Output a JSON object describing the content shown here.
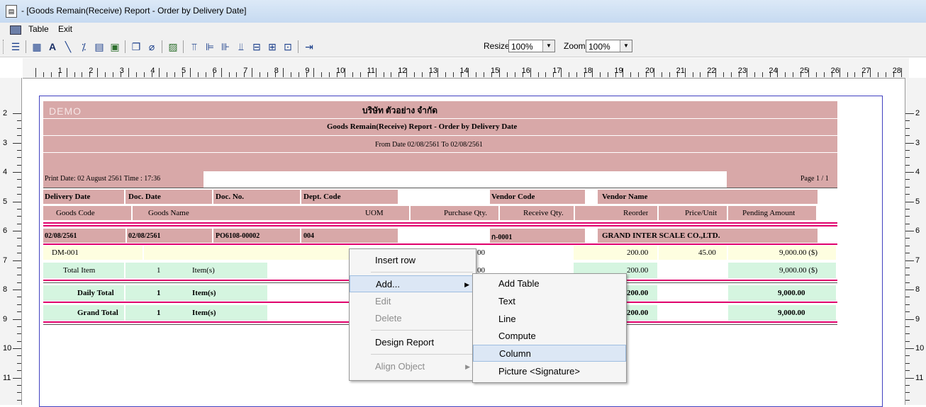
{
  "window": {
    "title": "- [Goods Remain(Receive) Report - Order by Delivery Date]"
  },
  "menu": {
    "items": [
      "Table",
      "Exit"
    ]
  },
  "toolbar": {
    "resize_label": "Resize:",
    "resize_value": "100%",
    "zoom_label": "Zoom:",
    "zoom_value": "100%"
  },
  "ruler": {
    "h": [
      "1",
      "2",
      "3",
      "4",
      "5",
      "6",
      "7",
      "8",
      "9",
      "10",
      "11",
      "12",
      "13",
      "14",
      "15",
      "16",
      "17",
      "18",
      "19",
      "20",
      "21",
      "22",
      "23",
      "24",
      "25",
      "26",
      "27",
      "28"
    ],
    "v": [
      "2",
      "3",
      "4",
      "5",
      "6",
      "7",
      "8",
      "9",
      "10",
      "11"
    ]
  },
  "report": {
    "watermark": "DEMO",
    "company": "บริษัท ตัวอย่าง จำกัด",
    "title": "Goods Remain(Receive) Report - Order by Delivery Date",
    "date_range": "From Date 02/08/2561 To 02/08/2561",
    "print_date": "Print Date: 02 August 2561  Time : 17:36",
    "page": "Page 1 / 1",
    "header1": [
      "Delivery Date",
      "Doc. Date",
      "Doc. No.",
      "Dept. Code",
      "Vendor Code",
      "Vendor Name"
    ],
    "header2": [
      "Goods Code",
      "Goods Name",
      "UOM",
      "Purchase Qty.",
      "Receive Qty.",
      "Reorder",
      "Price/Unit",
      "Pending Amount"
    ],
    "group": {
      "delivery_date": "02/08/2561",
      "doc_date": "02/08/2561",
      "doc_no": "PO6108-00002",
      "dept": "004",
      "vendor_code": "ก-0001",
      "vendor_name": "GRAND INTER SCALE CO.,LTD."
    },
    "detail": {
      "goods_code": "DM-001",
      "qty_partial": "00",
      "reorder": "200.00",
      "price": "45.00",
      "pending": "9,000.00 ($)"
    },
    "total_item": {
      "label": "Total Item",
      "count": "1",
      "unit": "Item(s)",
      "qty_partial": "00",
      "reorder": "200.00",
      "pending": "9,000.00 ($)"
    },
    "daily_total": {
      "label": "Daily Total",
      "count": "1",
      "unit": "Item(s)",
      "reorder": "200.00",
      "pending": "9,000.00"
    },
    "grand_total": {
      "label": "Grand Total",
      "count": "1",
      "unit": "Item(s)",
      "reorder": "200.00",
      "pending": "9,000.00"
    }
  },
  "context_menu": {
    "items": [
      "Insert row",
      "Add...",
      "Edit",
      "Delete",
      "Design Report",
      "Align Object"
    ]
  },
  "submenu": {
    "items": [
      "Add Table",
      "Text",
      "Line",
      "Compute",
      "Column",
      "Picture <Signature>"
    ]
  }
}
